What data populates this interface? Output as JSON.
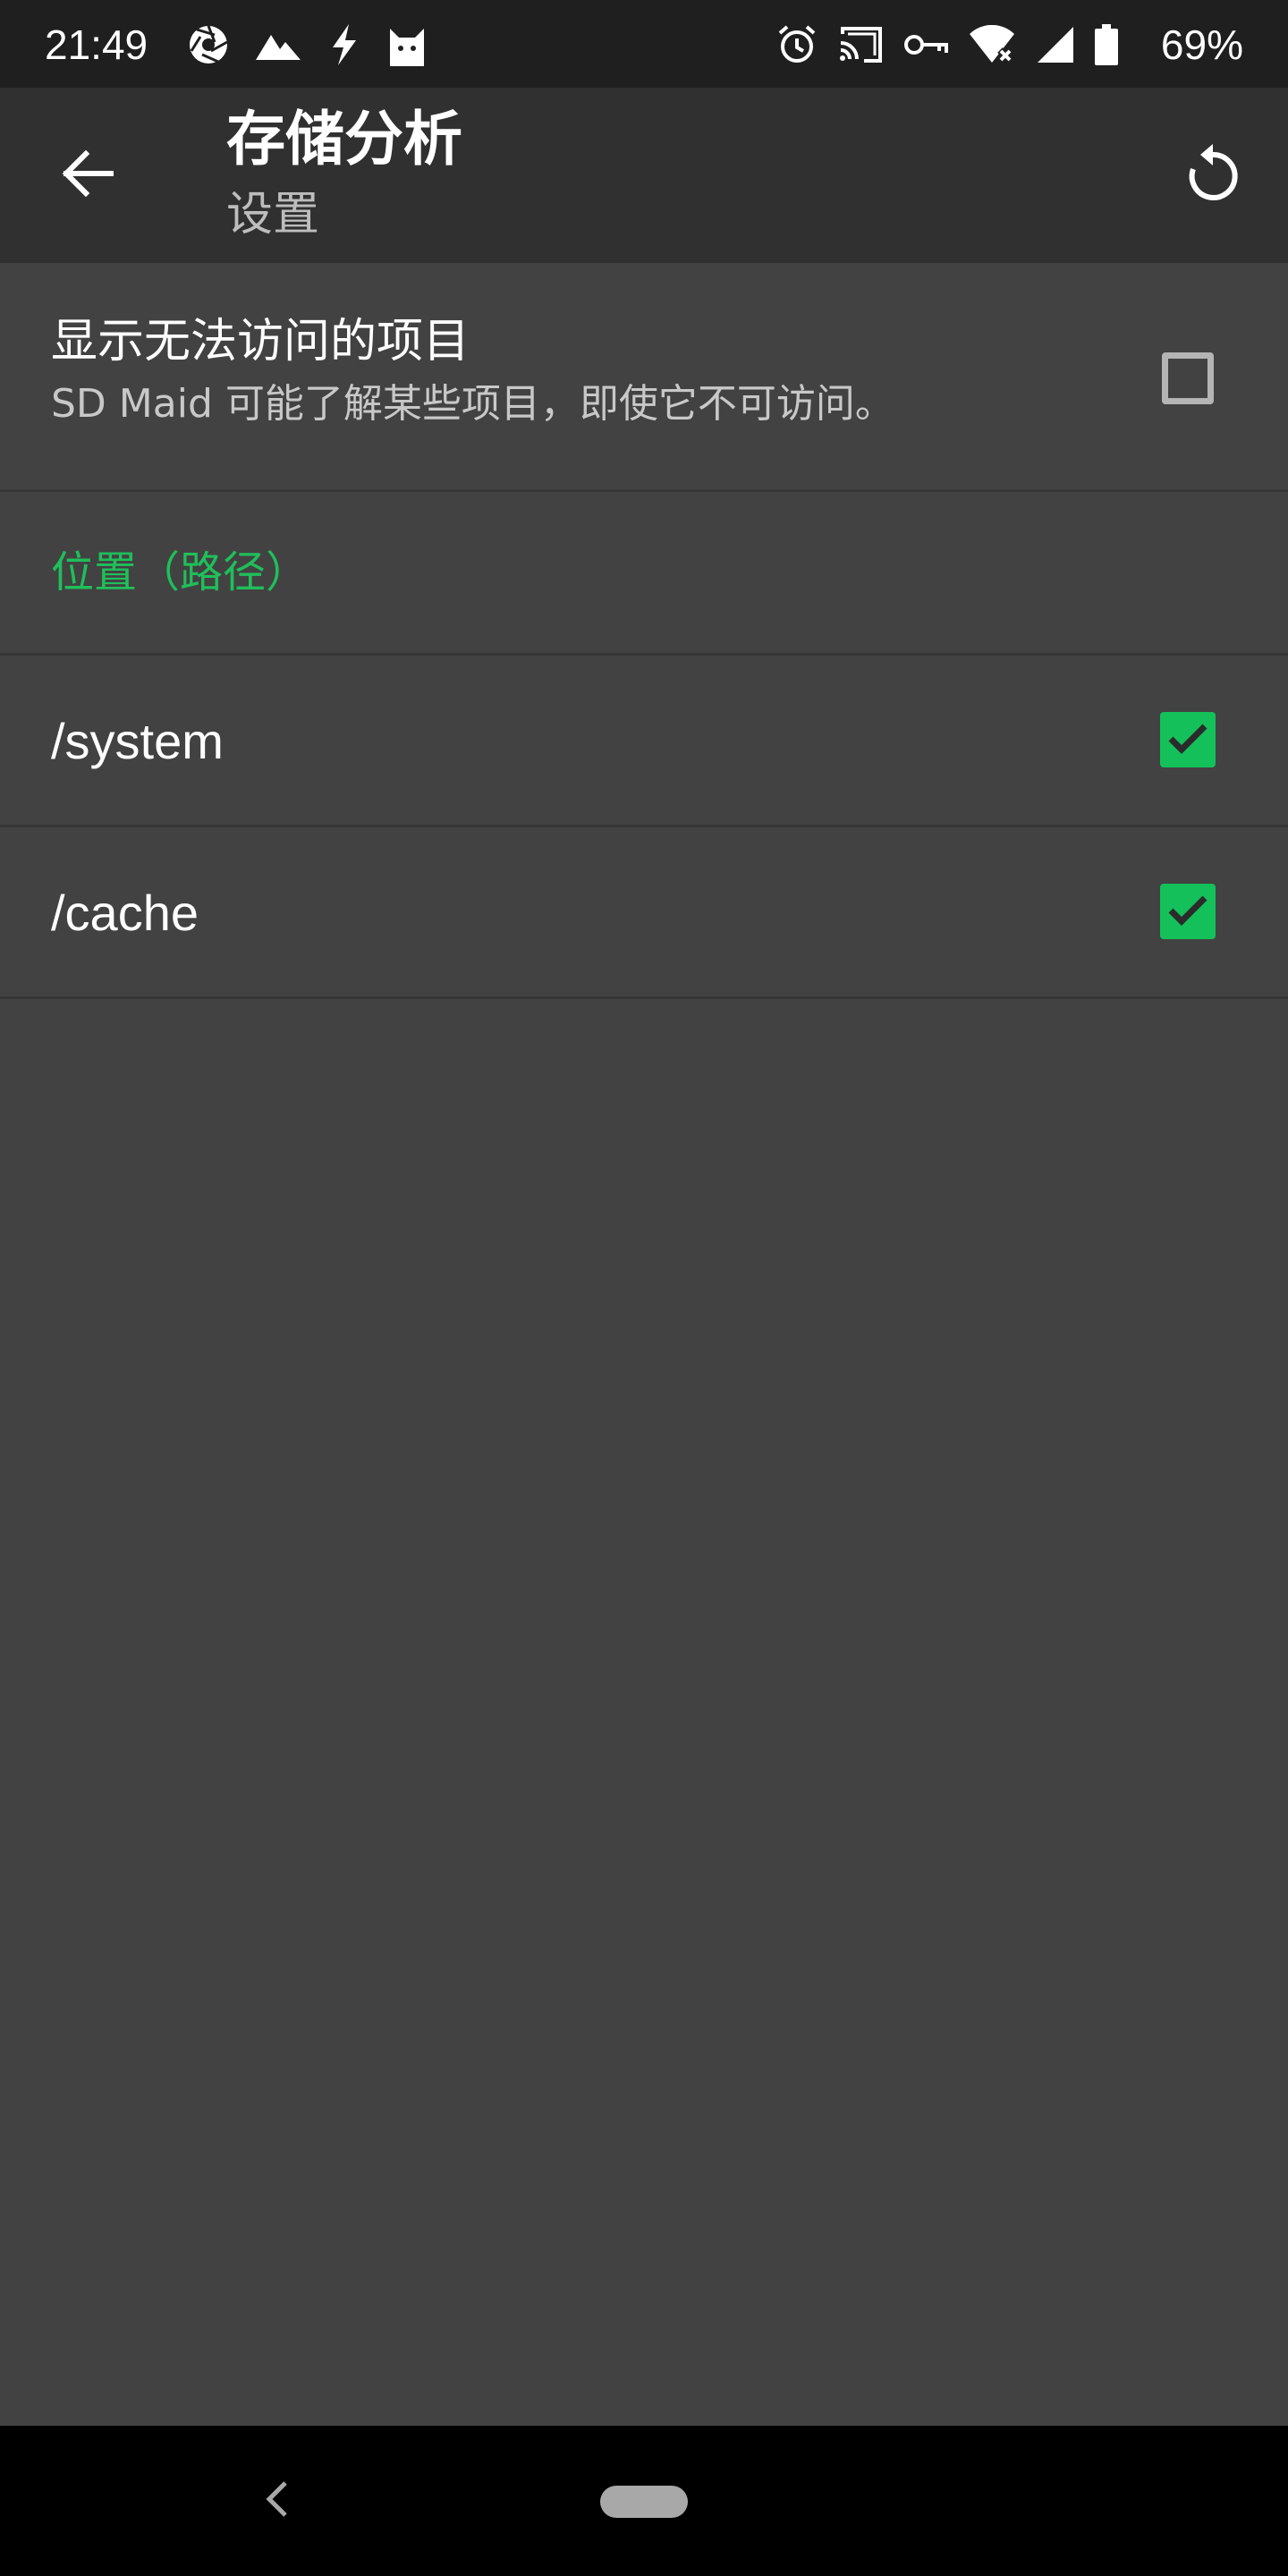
{
  "status_bar": {
    "time": "21:49",
    "left_icons": [
      "aperture-icon",
      "mountain-icon",
      "lightning-icon",
      "cat-icon"
    ],
    "right_icons": [
      "alarm-icon",
      "cast-icon",
      "vpn-key-icon",
      "wifi-off-icon",
      "cell-signal-icon",
      "battery-icon"
    ],
    "battery_percent": "69%"
  },
  "app_bar": {
    "title": "存储分析",
    "subtitle": "设置",
    "back_icon": "arrow-back-icon",
    "reset_icon": "restore-icon"
  },
  "preferences": {
    "show_inaccessible": {
      "title": "显示无法访问的项目",
      "summary": "SD Maid 可能了解某些项目，即使它不可访问。",
      "checked": false
    },
    "category_title": "位置（路径）",
    "paths": [
      {
        "label": "/system",
        "checked": true
      },
      {
        "label": "/cache",
        "checked": true
      }
    ]
  },
  "colors": {
    "accent": "#1fbf5a",
    "checkbox_checked": "#14c05a",
    "background": "#424242",
    "app_bar": "#303030",
    "status_bar": "#1f1f1f"
  }
}
